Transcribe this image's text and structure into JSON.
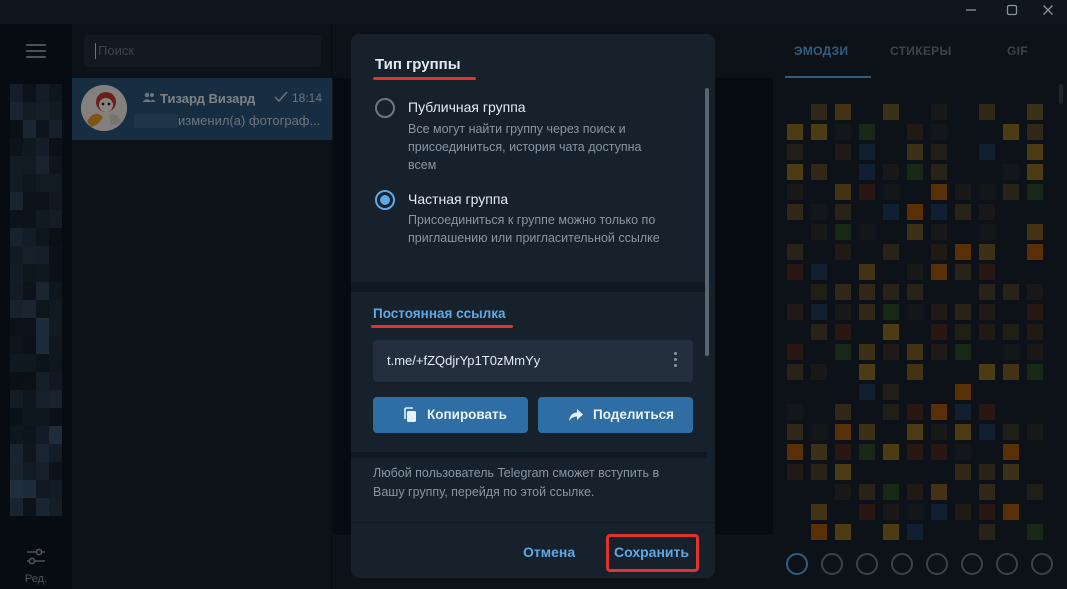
{
  "window": {
    "minimize_icon": "minimize-icon",
    "maximize_icon": "maximize-icon",
    "close_icon": "close-icon"
  },
  "rail": {
    "menu_icon": "hamburger-menu-icon",
    "edit_label": "Ред.",
    "edit_icon": "sliders-icon"
  },
  "chat_list": {
    "search_placeholder": "Поиск",
    "chats": [
      {
        "name": "Тизард Визард",
        "time": "18:14",
        "preview": "изменил(а) фотограф...",
        "type_icon": "group-icon",
        "status_icon": "check-icon"
      }
    ]
  },
  "emoji_panel": {
    "tabs": [
      "ЭМОДЗИ",
      "СТИКЕРЫ",
      "GIF"
    ],
    "active_tab": "ЭМОДЗИ",
    "category_icons": [
      "clock-icon",
      "smile-icon",
      "cat-icon",
      "apple-icon",
      "ball-icon",
      "car-icon",
      "lightbulb-icon",
      "heart-icon"
    ]
  },
  "modal": {
    "section_title": "Тип группы",
    "options": [
      {
        "title": "Публичная группа",
        "description": "Все могут найти группу через поиск и присоединиться, история чата доступна всем",
        "selected": false
      },
      {
        "title": "Частная группа",
        "description": "Присоединиться к группе можно только по приглашению или пригласительной ссылке",
        "selected": true
      }
    ],
    "link_section_title": "Постоянная ссылка",
    "link_value": "t.me/+fZQdjrYp1T0zMmYy",
    "copy_label": "Копировать",
    "share_label": "Поделиться",
    "info_text": "Любой пользователь Telegram сможет вступить в Вашу группу, перейдя по этой ссылке.",
    "cancel_label": "Отмена",
    "save_label": "Сохранить"
  },
  "colors": {
    "accent": "#5ea9e5",
    "highlight": "#e0332c",
    "button_blue": "#2f6ea5",
    "selected_chat": "#2b5278"
  }
}
